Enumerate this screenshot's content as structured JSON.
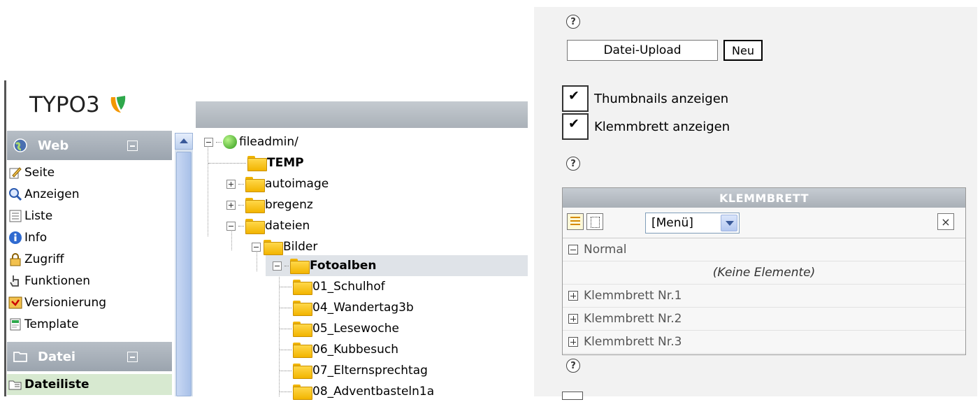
{
  "logo": {
    "text": "TYPO3",
    "accent": "#f49700"
  },
  "modules": {
    "web": {
      "label": "Web",
      "items": [
        {
          "label": "Seite",
          "icon": "pencil-page-icon"
        },
        {
          "label": "Anzeigen",
          "icon": "magnifier-icon"
        },
        {
          "label": "Liste",
          "icon": "list-icon"
        },
        {
          "label": "Info",
          "icon": "info-icon"
        },
        {
          "label": "Zugriff",
          "icon": "lock-icon"
        },
        {
          "label": "Funktionen",
          "icon": "hand-icon"
        },
        {
          "label": "Versionierung",
          "icon": "versioning-icon"
        },
        {
          "label": "Template",
          "icon": "template-icon"
        }
      ]
    },
    "datei": {
      "label": "Datei",
      "items": [
        {
          "label": "Dateiliste",
          "icon": "filelist-icon",
          "active": true
        }
      ]
    }
  },
  "tree": {
    "root": "fileadmin/",
    "items": [
      {
        "label": "TEMP"
      },
      {
        "label": "autoimage"
      },
      {
        "label": "bregenz"
      },
      {
        "label": "dateien"
      },
      {
        "label": "Bilder"
      },
      {
        "label": "Fotoalben"
      },
      {
        "label": "01_Schulhof"
      },
      {
        "label": "04_Wandertag3b"
      },
      {
        "label": "05_Lesewoche"
      },
      {
        "label": "06_Kubbesuch"
      },
      {
        "label": "07_Elternsprechtag"
      },
      {
        "label": "08_Adventbasteln1a"
      }
    ]
  },
  "right": {
    "help_symbol": "?",
    "upload_label": "Datei-Upload",
    "neu_label": "Neu",
    "thumbnails_label": "Thumbnails anzeigen",
    "clipboard_label": "Klemmbrett anzeigen",
    "clip": {
      "title": "KLEMMBRETT",
      "menu_value": "[Menü]",
      "close_symbol": "×",
      "normal": "Normal",
      "empty": "(Keine Elemente)",
      "pads": [
        "Klemmbrett Nr.1",
        "Klemmbrett Nr.2",
        "Klemmbrett Nr.3"
      ]
    }
  }
}
